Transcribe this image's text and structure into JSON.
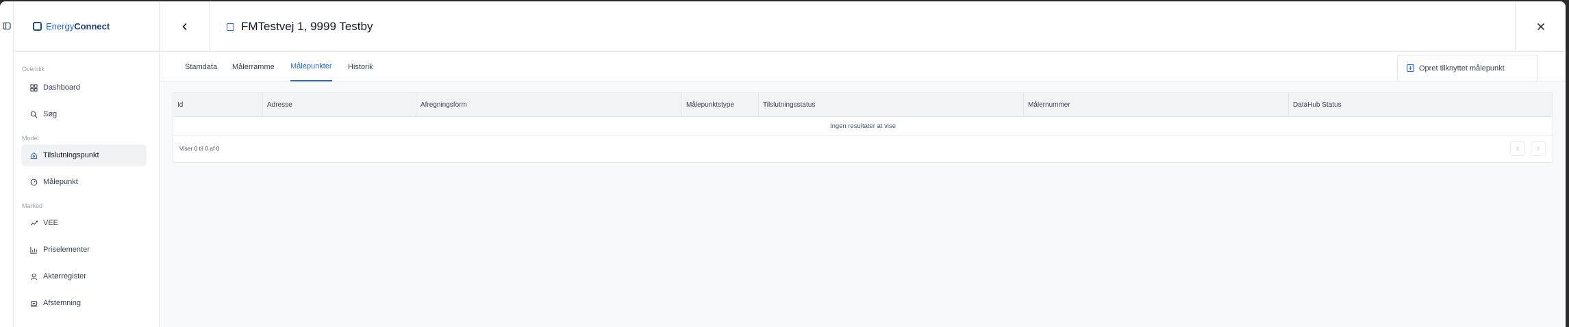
{
  "brand": {
    "name_part1": "Energy",
    "name_part2": "Connect"
  },
  "sidebar": {
    "sections": [
      {
        "label": "Overblik",
        "items": [
          {
            "label": "Dashboard",
            "icon": "grid-icon"
          },
          {
            "label": "Søg",
            "icon": "search-icon"
          }
        ]
      },
      {
        "label": "Model",
        "items": [
          {
            "label": "Tilslutningspunkt",
            "icon": "home-icon",
            "active": true
          },
          {
            "label": "Målepunkt",
            "icon": "gauge-icon"
          }
        ]
      },
      {
        "label": "Marked",
        "items": [
          {
            "label": "VEE",
            "icon": "trend-icon"
          },
          {
            "label": "Priselementer",
            "icon": "chart-icon"
          },
          {
            "label": "Aktørregister",
            "icon": "user-icon"
          },
          {
            "label": "Afstemning",
            "icon": "scale-icon"
          }
        ]
      }
    ]
  },
  "header": {
    "title": "FMTestvej 1, 9999 Testby"
  },
  "tabs": [
    {
      "label": "Stamdata",
      "active": false
    },
    {
      "label": "Målerramme",
      "active": false
    },
    {
      "label": "Målepunkter",
      "active": true
    },
    {
      "label": "Historik",
      "active": false
    }
  ],
  "actions": {
    "create_label": "Opret tilknyttet målepunkt"
  },
  "table": {
    "columns": [
      "Id",
      "Adresse",
      "Afregningsform",
      "Målepunktstype",
      "Tilslutningsstatus",
      "Målernummer",
      "DataHub Status"
    ],
    "empty_text": "Ingen resultater at vise",
    "showing_text": "Viser 0 til 0 af 0"
  },
  "colors": {
    "accent": "#2563eb",
    "brand_dark": "#1e3a8a"
  }
}
